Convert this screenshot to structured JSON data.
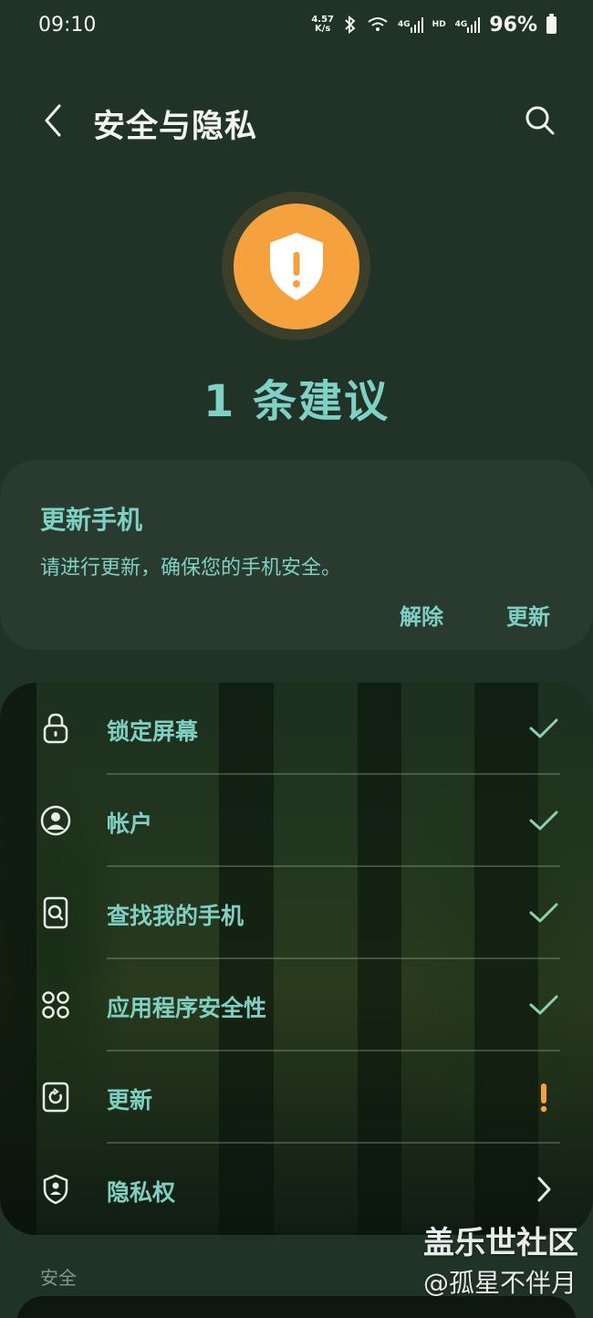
{
  "status_bar": {
    "time": "09:10",
    "speed_value": "4.57",
    "speed_unit": "K/s",
    "net1": "4G",
    "hd": "HD",
    "net2": "4G",
    "battery": "96%"
  },
  "header": {
    "title": "安全与隐私",
    "back_icon": "chevron-left-icon",
    "search_icon": "search-icon"
  },
  "hero": {
    "icon": "shield-warning-icon",
    "accent": "#f5a13e",
    "suggestion_count": "1 条建议"
  },
  "suggestion_card": {
    "title": "更新手机",
    "description": "请进行更新，确保您的手机安全。",
    "dismiss_label": "解除",
    "update_label": "更新"
  },
  "list": {
    "items": [
      {
        "label": "锁定屏幕",
        "icon": "lock-icon",
        "status": "ok"
      },
      {
        "label": "帐户",
        "icon": "account-icon",
        "status": "ok"
      },
      {
        "label": "查找我的手机",
        "icon": "find-phone-icon",
        "status": "ok"
      },
      {
        "label": "应用程序安全性",
        "icon": "apps-icon",
        "status": "ok"
      },
      {
        "label": "更新",
        "icon": "update-icon",
        "status": "warning"
      },
      {
        "label": "隐私权",
        "icon": "privacy-shield-icon",
        "status": "chevron"
      }
    ],
    "check_color": "#8ecfb4",
    "warning_color": "#f5a13e"
  },
  "section": {
    "label": "安全"
  },
  "watermark": {
    "line1": "盖乐世社区",
    "line2": "@孤星不伴月"
  }
}
